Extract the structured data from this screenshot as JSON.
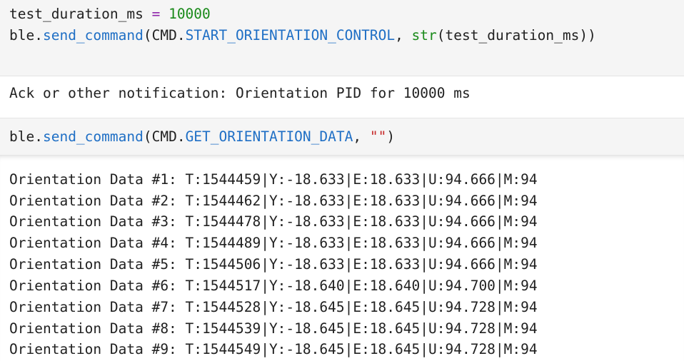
{
  "cell1": {
    "line1": {
      "var": "test_duration_ms",
      "op": " = ",
      "num": "10000"
    },
    "line2": {
      "obj": "ble.",
      "method": "send_command",
      "open": "(CMD.",
      "const": "START_ORIENTATION_CONTROL",
      "sep": ", ",
      "builtin": "str",
      "rest": "(test_duration_ms))"
    }
  },
  "output1": "Ack or other notification: Orientation PID for 10000 ms",
  "cell2": {
    "obj": "ble.",
    "method": "send_command",
    "open": "(CMD.",
    "const": "GET_ORIENTATION_DATA",
    "sep": ", ",
    "str": "\"\"",
    "close": ")"
  },
  "output2": [
    "Orientation Data #1: T:1544459|Y:-18.633|E:18.633|U:94.666|M:94",
    "Orientation Data #2: T:1544462|Y:-18.633|E:18.633|U:94.666|M:94",
    "Orientation Data #3: T:1544478|Y:-18.633|E:18.633|U:94.666|M:94",
    "Orientation Data #4: T:1544489|Y:-18.633|E:18.633|U:94.666|M:94",
    "Orientation Data #5: T:1544506|Y:-18.633|E:18.633|U:94.666|M:94",
    "Orientation Data #6: T:1544517|Y:-18.640|E:18.640|U:94.700|M:94",
    "Orientation Data #7: T:1544528|Y:-18.645|E:18.645|U:94.728|M:94",
    "Orientation Data #8: T:1544539|Y:-18.645|E:18.645|U:94.728|M:94",
    "Orientation Data #9: T:1544549|Y:-18.645|E:18.645|U:94.728|M:94"
  ],
  "colors": {
    "function": "#1f6fc5",
    "number": "#1a8a1a",
    "operator": "#8e24aa",
    "string": "#c62828",
    "cell_background": "#f5f5f5"
  }
}
